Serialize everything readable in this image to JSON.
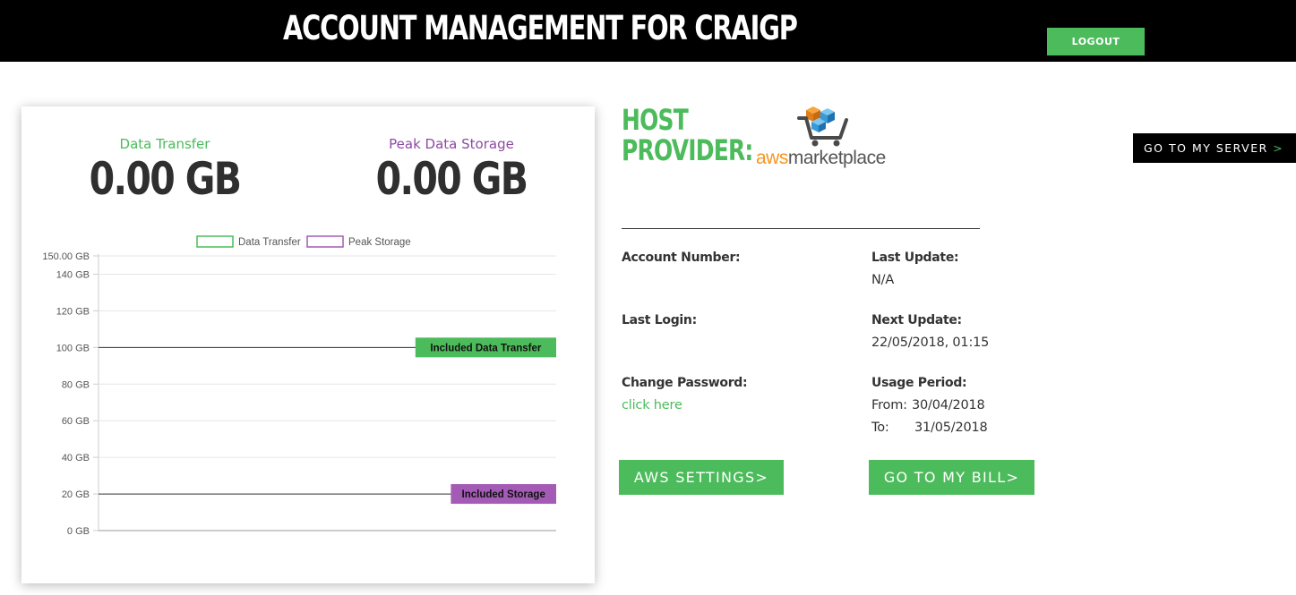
{
  "header": {
    "title": "ACCOUNT MANAGEMENT FOR CRAIGP",
    "logout_label": "LOGOUT"
  },
  "usage": {
    "data_transfer": {
      "label": "Data Transfer",
      "value": "0.00 GB"
    },
    "peak_storage": {
      "label": "Peak Data Storage",
      "value": "0.00 GB"
    }
  },
  "chart_data": {
    "type": "line",
    "legend": [
      {
        "name": "Data Transfer",
        "color": "#4cbb5b"
      },
      {
        "name": "Peak Storage",
        "color": "#a45bb5"
      }
    ],
    "legend_position": "top-center",
    "ylim": [
      0,
      150
    ],
    "y_ticks": [
      {
        "value": 0,
        "label": "0 GB"
      },
      {
        "value": 20,
        "label": "20 GB"
      },
      {
        "value": 40,
        "label": "40 GB"
      },
      {
        "value": 60,
        "label": "60 GB"
      },
      {
        "value": 80,
        "label": "80 GB"
      },
      {
        "value": 100,
        "label": "100 GB"
      },
      {
        "value": 120,
        "label": "120 GB"
      },
      {
        "value": 140,
        "label": "140 GB"
      },
      {
        "value": 150,
        "label": "150.00 GB"
      }
    ],
    "grid": true,
    "series": [
      {
        "name": "Data Transfer",
        "values": []
      },
      {
        "name": "Peak Storage",
        "values": []
      }
    ],
    "annotations": [
      {
        "label": "Included Data Transfer",
        "y": 100,
        "color": "#4cbb5b"
      },
      {
        "label": "Included Storage",
        "y": 20,
        "color": "#a45bb5"
      }
    ]
  },
  "host": {
    "title_line1": "HOST",
    "title_line2": "PROVIDER:",
    "logo_text_aws": "aws",
    "logo_text_marketplace": "marketplace",
    "go_to_server_label": "GO TO MY SERVER",
    "go_to_server_arrow": ">"
  },
  "account": {
    "account_number_label": "Account Number:",
    "last_update_label": "Last Update:",
    "last_update_value": "N/A",
    "last_login_label": "Last Login:",
    "next_update_label": "Next Update:",
    "next_update_value": "22/05/2018, 01:15",
    "change_password_label": "Change Password:",
    "change_password_link": "click here",
    "usage_period_label": "Usage Period:",
    "from_label": "From:",
    "from_value": "30/04/2018",
    "to_label": "To:",
    "to_value": "31/05/2018"
  },
  "actions": {
    "aws_settings_label": "AWS SETTINGS>",
    "go_to_bill_label": "GO TO MY BILL>"
  },
  "colors": {
    "accent_green": "#4cbb5b",
    "accent_purple": "#a45bb5",
    "header_bg": "#000000"
  }
}
